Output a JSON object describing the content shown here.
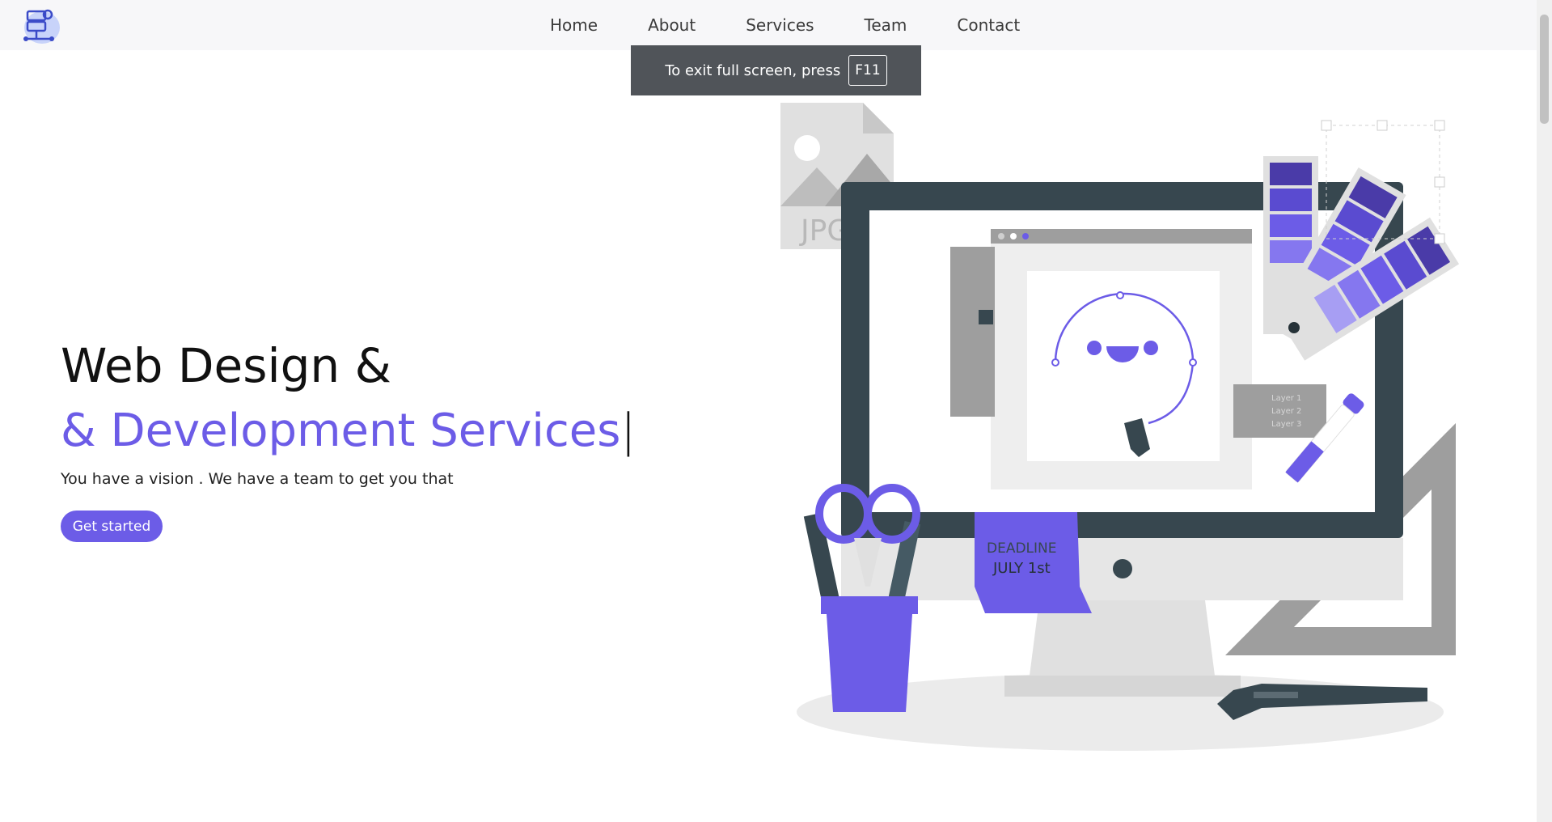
{
  "nav": {
    "items": [
      {
        "label": "Home"
      },
      {
        "label": "About"
      },
      {
        "label": "Services"
      },
      {
        "label": "Team"
      },
      {
        "label": "Contact"
      }
    ]
  },
  "toast": {
    "text": "To exit full screen, press",
    "key": "F11"
  },
  "hero": {
    "title": "Web Design &",
    "subtitle": "& Development Services",
    "caret": "|",
    "tagline": "You have a vision . We have a team to get you that",
    "cta_label": "Get started"
  },
  "illustration": {
    "jpg_label": "JPG",
    "note_line1": "DEADLINE",
    "note_line2": "JULY 1st",
    "layers": [
      "Layer 1",
      "Layer 2",
      "Layer 3"
    ]
  },
  "colors": {
    "accent": "#6c5ce7",
    "monitor": "#37474f"
  }
}
